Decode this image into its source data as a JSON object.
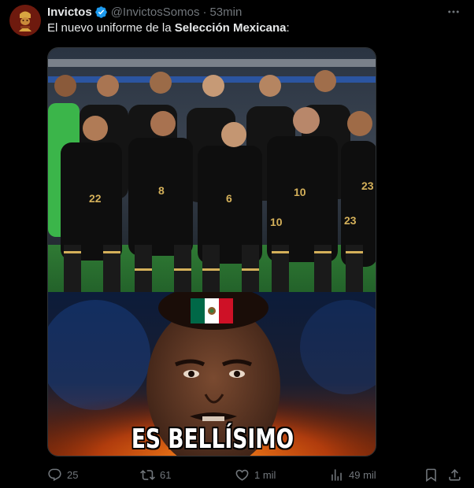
{
  "author": {
    "name": "Invictos",
    "handle": "@InvictosSomos",
    "separator": "·",
    "time": "53min",
    "verified_color": "#1d9bf0"
  },
  "tweet": {
    "text_prefix": "El nuevo uniforme de la ",
    "text_bold": "Selección Mexicana",
    "text_suffix": ":"
  },
  "media": {
    "meme_caption": "ES BELLÍSIMO"
  },
  "actions": {
    "replies": "25",
    "reposts": "61",
    "likes": "1 mil",
    "views": "49 mil"
  },
  "icons": {
    "more": "more-options-icon",
    "reply": "reply-icon",
    "repost": "repost-icon",
    "like": "like-icon",
    "views": "views-icon",
    "bookmark": "bookmark-icon",
    "share": "share-icon"
  },
  "colors": {
    "background": "#000000",
    "text": "#e7e9ea",
    "muted": "#71767b",
    "border": "#2f3336"
  }
}
